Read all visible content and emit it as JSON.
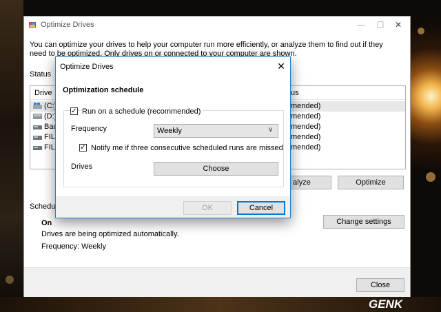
{
  "main_window": {
    "title": "Optimize Drives",
    "controls": {
      "minimize": "—",
      "maximize": "☐",
      "close": "✕"
    },
    "intro_text": "You can optimize your drives to help your computer run more efficiently, or analyze them to find out if they need to be optimized. Only drives on or connected to your computer are shown.",
    "status_label": "Status",
    "columns": {
      "drive": "Drive",
      "status": "us"
    },
    "drives": [
      {
        "name": "(C:)",
        "status": "mended)"
      },
      {
        "name": "(D:)",
        "status": "mended)"
      },
      {
        "name": "Back",
        "status": "mended)"
      },
      {
        "name": "FILE",
        "status": "mended)"
      },
      {
        "name": "FILE",
        "status": "mended)"
      }
    ],
    "analyze_label": "alyze",
    "optimize_label": "Optimize",
    "scheduled_label": "Schedule",
    "schedule_state": "On",
    "schedule_description": "Drives are being optimized automatically.",
    "schedule_frequency": "Frequency: Weekly",
    "change_settings_label": "Change settings",
    "close_label": "Close"
  },
  "dialog": {
    "title": "Optimize Drives",
    "close_glyph": "✕",
    "heading": "Optimization schedule",
    "run_on_schedule": {
      "label": "Run on a schedule (recommended)",
      "checked": true,
      "check_glyph": "✓"
    },
    "frequency_label": "Frequency",
    "frequency_value": "Weekly",
    "frequency_arrow": "∨",
    "notify": {
      "label": "Notify me if three consecutive scheduled runs are missed",
      "checked": true,
      "check_glyph": "✓"
    },
    "drives_label": "Drives",
    "choose_label": "Choose",
    "ok_label": "OK",
    "cancel_label": "Cancel"
  },
  "watermark": "GENK",
  "colors": {
    "accent": "#0078d7",
    "button": "#e1e1e1",
    "footer": "#f0f0f0"
  }
}
